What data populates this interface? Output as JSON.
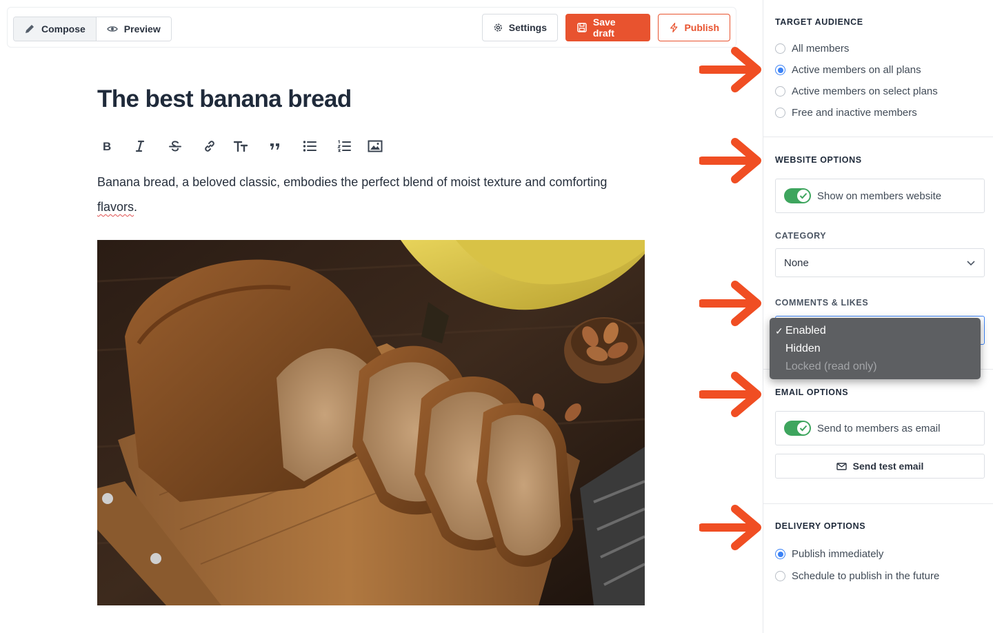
{
  "toolbar": {
    "compose_label": "Compose",
    "preview_label": "Preview",
    "settings_label": "Settings",
    "save_label": "Save draft",
    "publish_label": "Publish"
  },
  "editor": {
    "title": "The best banana bread",
    "body_text": "Banana bread, a beloved classic, embodies the perfect blend of moist texture and comforting",
    "body_misspelled": "flavors",
    "body_end": ".",
    "format_tools": [
      "bold",
      "italic",
      "strikethrough",
      "link",
      "heading",
      "quote",
      "bulleted-list",
      "numbered-list",
      "image"
    ]
  },
  "sidebar": {
    "target_audience": {
      "title": "TARGET AUDIENCE",
      "options": [
        "All members",
        "Active members on all plans",
        "Active members on select plans",
        "Free and inactive members"
      ],
      "selected": "Active members on all plans"
    },
    "website_options": {
      "title": "WEBSITE OPTIONS",
      "toggle_label": "Show on members website",
      "toggle_on": true
    },
    "category": {
      "title": "CATEGORY",
      "value": "None"
    },
    "comments_likes": {
      "title": "COMMENTS & LIKES",
      "options": [
        "Enabled",
        "Hidden",
        "Locked (read only)"
      ],
      "selected": "Enabled",
      "check_mark": "✓"
    },
    "email_options": {
      "title": "EMAIL OPTIONS",
      "toggle_label": "Send to members as email",
      "toggle_on": true,
      "test_button": "Send test email"
    },
    "delivery_options": {
      "title": "DELIVERY OPTIONS",
      "options": [
        "Publish immediately",
        "Schedule to publish in the future"
      ],
      "selected": "Publish immediately"
    }
  },
  "colors": {
    "accent": "#e8532f",
    "radio_selected": "#3b82f6",
    "toggle_on": "#3ea55e",
    "arrow": "#f04e23"
  }
}
